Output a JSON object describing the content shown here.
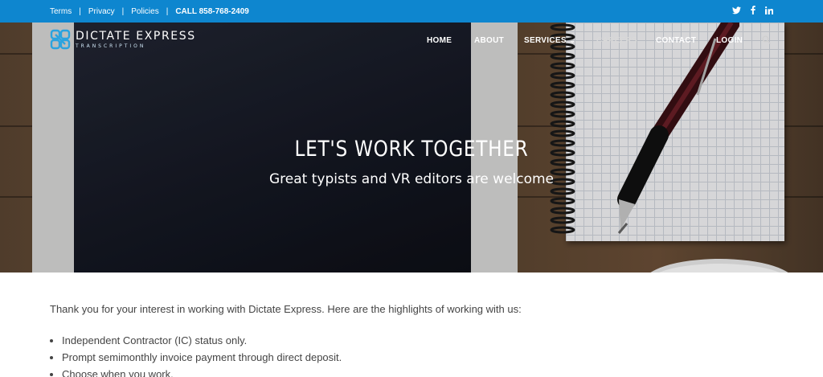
{
  "topbar": {
    "links": [
      "Terms",
      "Privacy",
      "Policies"
    ],
    "call": "CALL 858-768-2409",
    "separator": "|",
    "social_icons": [
      "twitter-icon",
      "facebook-icon",
      "linkedin-icon"
    ],
    "background": "#0e86cf"
  },
  "logo": {
    "brand": "DICTATE EXPRESS",
    "tagline": "TRANSCRIPTION",
    "mark_color": "#2aa3df"
  },
  "nav": {
    "items": [
      "HOME",
      "ABOUT",
      "SERVICES",
      "CAREERS",
      "CONTACT",
      "LOGIN"
    ],
    "services_icon": "chevron-down-icon",
    "search_icon": "search-icon"
  },
  "hero": {
    "title": "LET'S WORK TOGETHER",
    "subtitle": "Great typists and VR editors are welcome"
  },
  "content": {
    "intro": "Thank you for your interest in working with Dictate Express. Here are the highlights of working with us:",
    "bullets": [
      "Independent Contractor (IC) status only.",
      "Prompt semimonthly invoice payment through direct deposit.",
      "Choose when you work."
    ]
  }
}
